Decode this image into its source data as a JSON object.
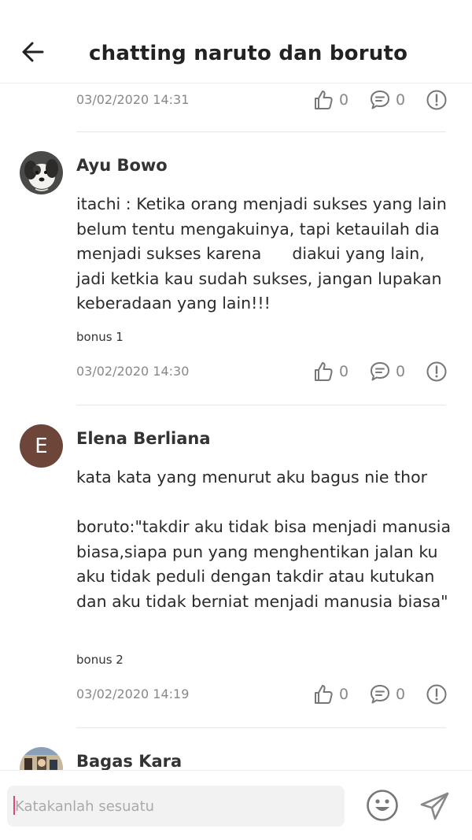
{
  "header": {
    "title": "chatting naruto dan boruto",
    "back_icon": "arrow-left-icon"
  },
  "comments": [
    {
      "date": "03/02/2020 14:31",
      "likes": "0",
      "replies": "0"
    },
    {
      "name": "Ayu Bowo",
      "avatar": "dog-photo",
      "text": "itachi : Ketika orang menjadi sukses yang lain belum tentu mengakuinya, tapi ketauilah dia menjadi sukses karena      diakui yang lain, jadi ketkia kau sudah sukses, jangan lupakan keberadaan yang lain!!!",
      "bonus": "bonus 1",
      "date": "03/02/2020 14:30",
      "likes": "0",
      "replies": "0"
    },
    {
      "name": "Elena Berliana",
      "avatar_letter": "E",
      "avatar_color": "#6d4639",
      "text": "kata kata yang menurut aku bagus nie thor\n\nboruto:\"takdir aku tidak bisa menjadi manusia biasa,siapa pun yang menghentikan jalan ku aku tidak peduli dengan takdir atau kutukan dan aku tidak berniat menjadi manusia biasa\"",
      "bonus": "bonus 2",
      "date": "03/02/2020 14:19",
      "likes": "0",
      "replies": "0"
    },
    {
      "name": "Bagas Kara",
      "avatar": "anime-photo"
    }
  ],
  "composer": {
    "placeholder": "Katakanlah sesuatu",
    "emoji_icon": "smiley-icon",
    "send_icon": "send-icon"
  }
}
